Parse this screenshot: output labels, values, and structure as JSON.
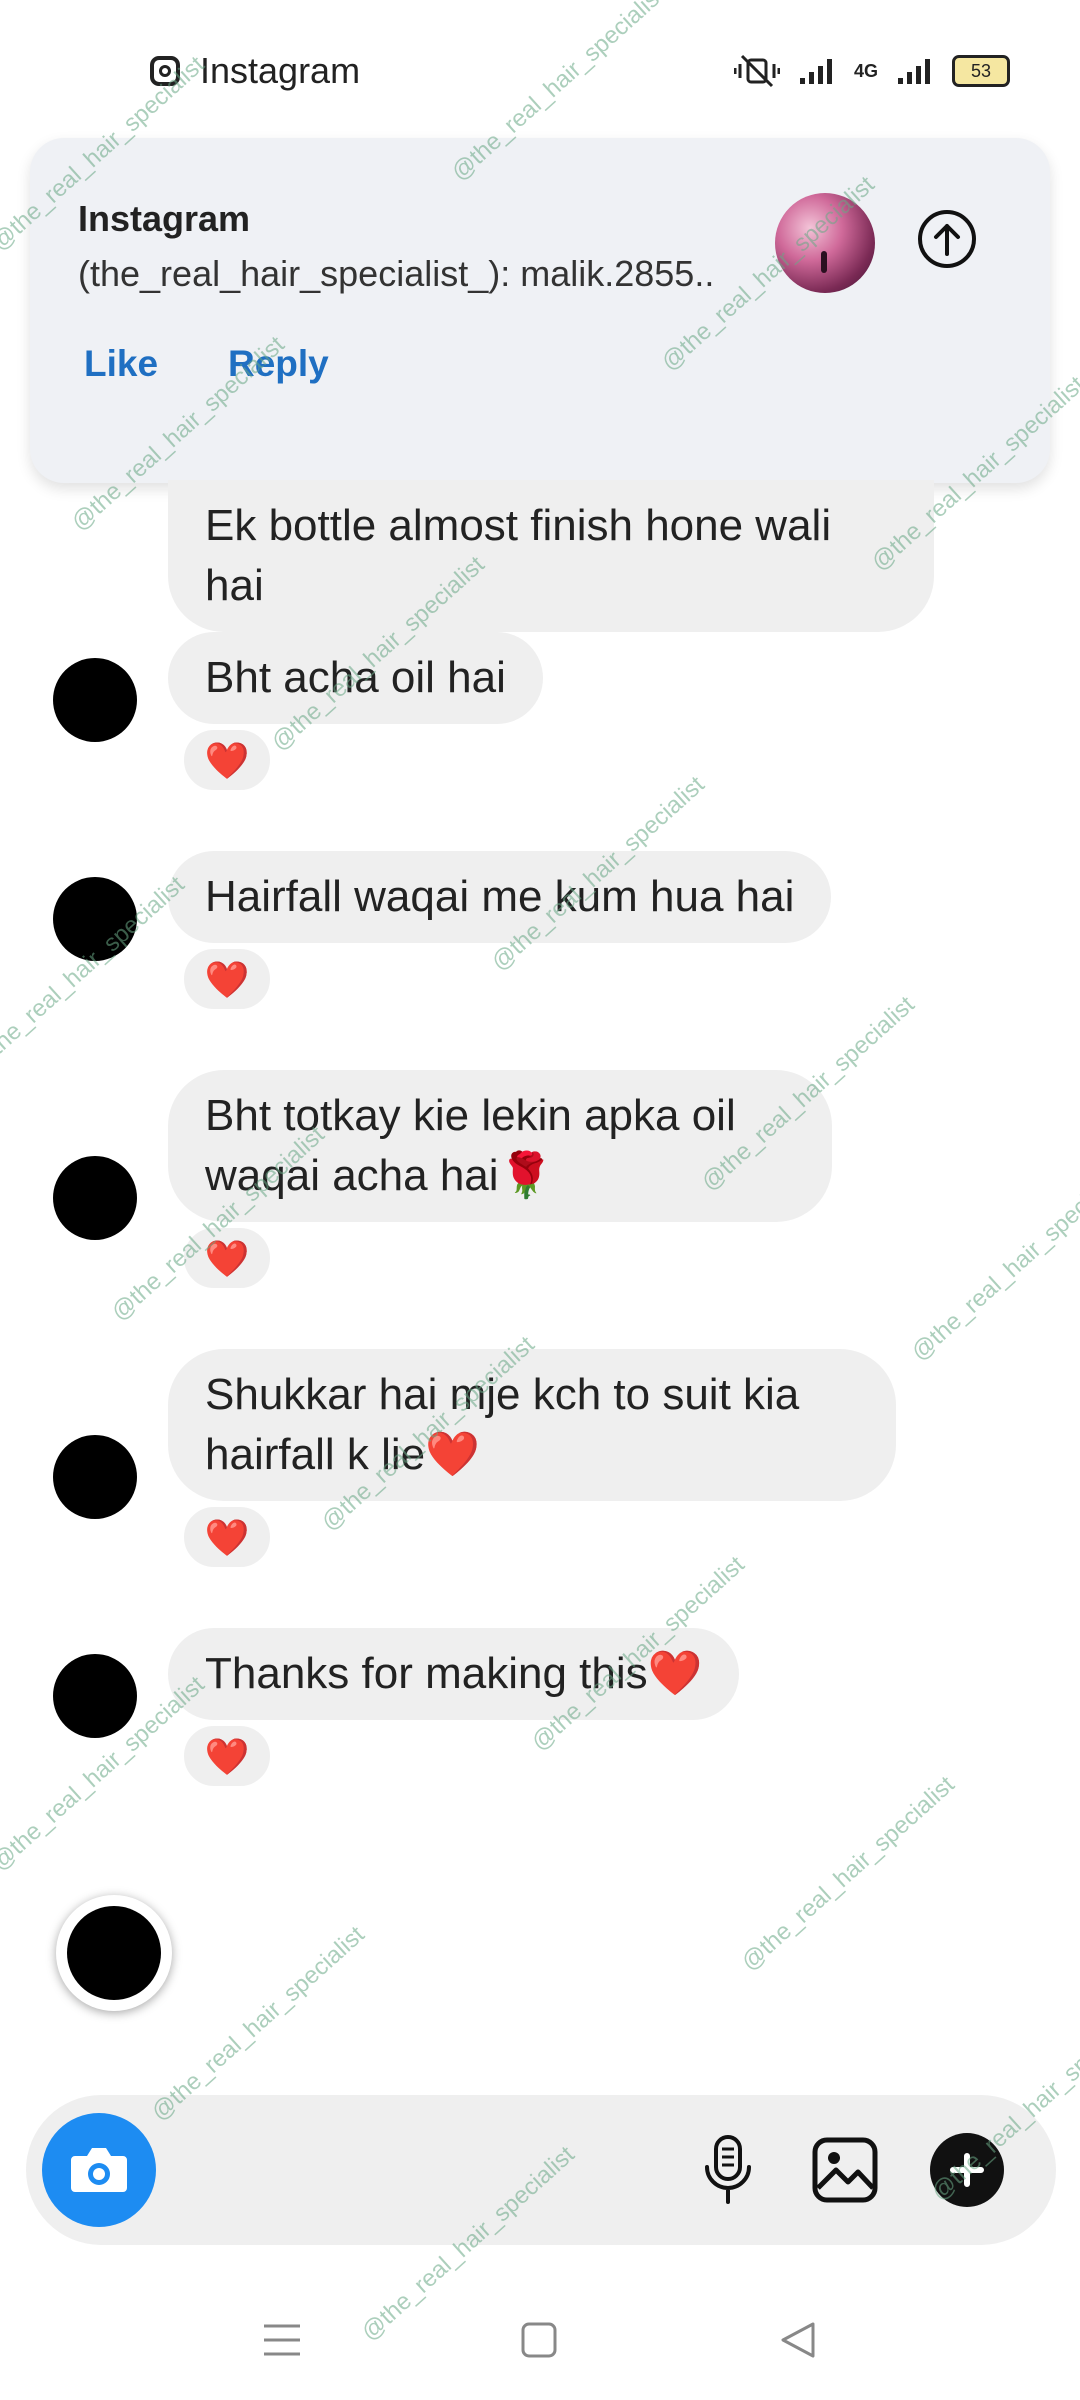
{
  "status_bar": {
    "app_name": "Instagram",
    "network": "4G",
    "battery": "53"
  },
  "notification": {
    "title": "Instagram",
    "body": "(the_real_hair_specialist_): malik.2855..",
    "actions": {
      "like": "Like",
      "reply": "Reply"
    }
  },
  "messages": [
    {
      "text": "Ek bottle almost finish hone wali hai",
      "reaction": ""
    },
    {
      "text": "Bht acha oil hai",
      "reaction": "❤️"
    },
    {
      "text": "Hairfall waqai me kum hua hai",
      "reaction": "❤️"
    },
    {
      "text": "Bht totkay kie lekin apka oil waqai acha hai🌹",
      "reaction": "❤️"
    },
    {
      "text": "Shukkar hai mje kch to suit kia hairfall k lie❤️",
      "reaction": "❤️"
    },
    {
      "text": "Thanks for making this❤️",
      "reaction": "❤️"
    }
  ],
  "watermark": "@the_real_hair_specialist",
  "colors": {
    "accent": "#1d8cf2",
    "link": "#1f6fc2",
    "bubble": "#efefef"
  }
}
